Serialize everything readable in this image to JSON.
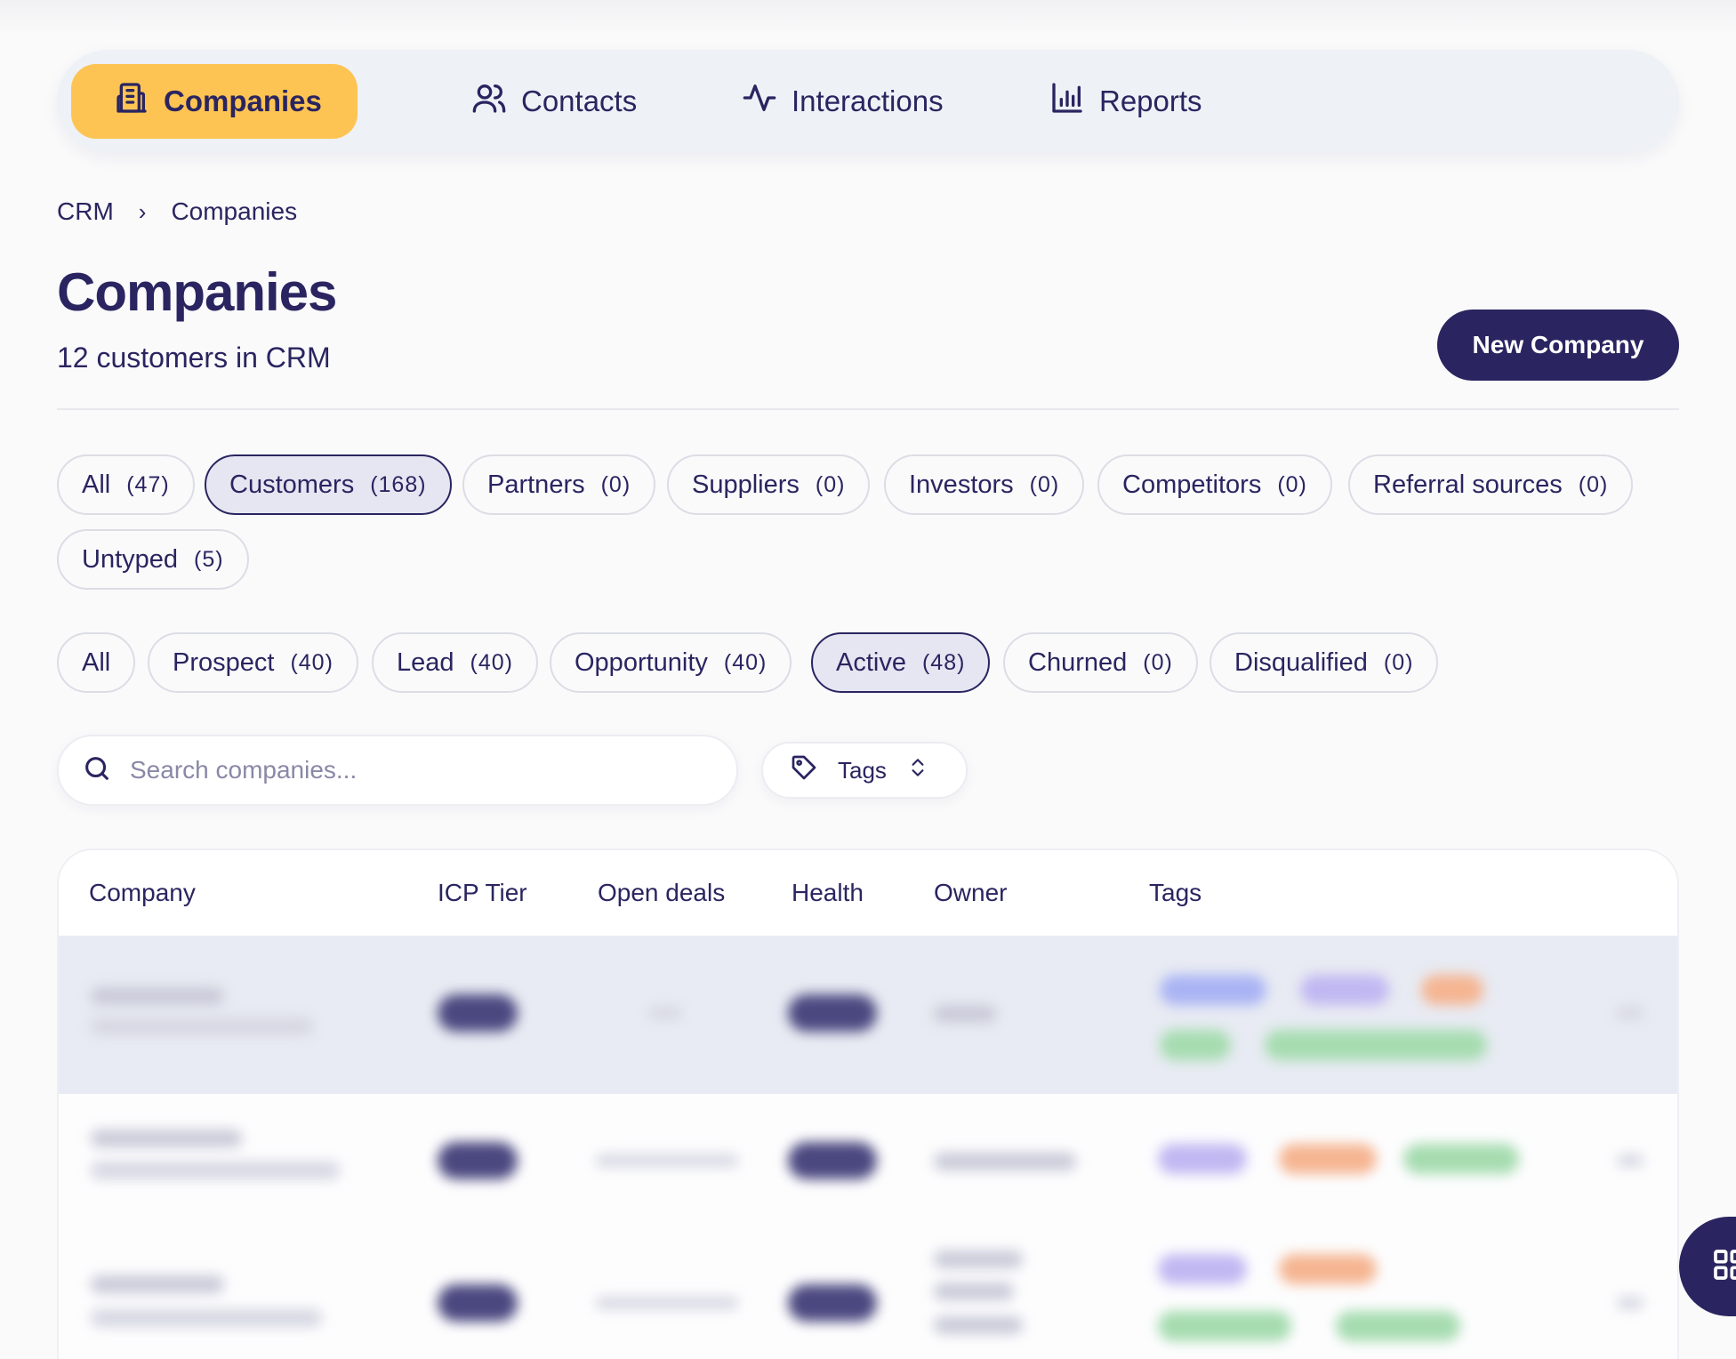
{
  "nav": {
    "items": [
      {
        "label": "Companies",
        "icon": "building-icon",
        "active": true
      },
      {
        "label": "Contacts",
        "icon": "users-icon",
        "active": false
      },
      {
        "label": "Interactions",
        "icon": "activity-icon",
        "active": false
      },
      {
        "label": "Reports",
        "icon": "bar-chart-icon",
        "active": false
      }
    ]
  },
  "breadcrumb": {
    "root": "CRM",
    "separator": "›",
    "current": "Companies"
  },
  "page": {
    "title": "Companies",
    "subtitle": "12 customers in CRM",
    "new_button": "New Company"
  },
  "type_filters": [
    {
      "label": "All",
      "count": "(47)",
      "selected": false
    },
    {
      "label": "Customers",
      "count": "(168)",
      "selected": true
    },
    {
      "label": "Partners",
      "count": "(0)",
      "selected": false
    },
    {
      "label": "Suppliers",
      "count": "(0)",
      "selected": false
    },
    {
      "label": "Investors",
      "count": "(0)",
      "selected": false
    },
    {
      "label": "Competitors",
      "count": "(0)",
      "selected": false
    },
    {
      "label": "Referral sources",
      "count": "(0)",
      "selected": false
    },
    {
      "label": "Untyped",
      "count": "(5)",
      "selected": false
    }
  ],
  "stage_filters": [
    {
      "label": "All",
      "count": "",
      "selected": false
    },
    {
      "label": "Prospect",
      "count": "(40)",
      "selected": false
    },
    {
      "label": "Lead",
      "count": "(40)",
      "selected": false
    },
    {
      "label": "Opportunity",
      "count": "(40)",
      "selected": false
    },
    {
      "label": "Active",
      "count": "(48)",
      "selected": true
    },
    {
      "label": "Churned",
      "count": "(0)",
      "selected": false
    },
    {
      "label": "Disqualified",
      "count": "(0)",
      "selected": false
    }
  ],
  "search": {
    "placeholder": "Search companies...",
    "value": ""
  },
  "tags_filter": {
    "label": "Tags"
  },
  "table": {
    "columns": [
      "Company",
      "ICP Tier",
      "Open deals",
      "Health",
      "Owner",
      "Tags"
    ]
  },
  "colors": {
    "accent": "#fdc453",
    "primary": "#2a2560",
    "nav_bg": "#eef1f6",
    "selected_pill_bg": "#e6e6f2"
  },
  "fab": {
    "icon": "grid-icon"
  }
}
